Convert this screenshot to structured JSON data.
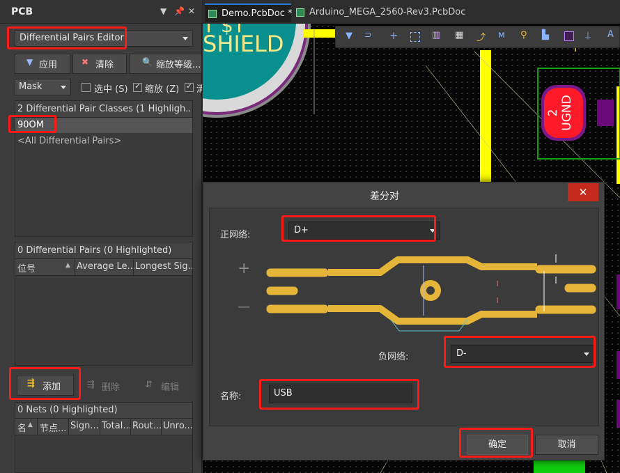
{
  "panel": {
    "title": "PCB",
    "mode_select": "Differential Pairs Editor",
    "buttons": {
      "apply": "应用",
      "clear": "清除",
      "zoom": "缩放等级..."
    },
    "mask_select": "Mask",
    "checkboxes": [
      {
        "label": "选中 (S)",
        "checked": false
      },
      {
        "label": "缩放 (Z)",
        "checked": true
      },
      {
        "label": "清",
        "checked": true
      }
    ],
    "classes_header": "2 Differential Pair Classes (1 Highligh...",
    "classes": [
      "90OM",
      "<All Differential Pairs>"
    ],
    "pairs_header": "0 Differential Pairs (0 Highlighted)",
    "pairs_columns": [
      "位号",
      "Average Le...",
      "Longest Sig..."
    ],
    "actions": {
      "add": "添加",
      "delete": "删除",
      "edit": "编辑"
    },
    "nets_header": "0 Nets (0 Highlighted)",
    "nets_columns": [
      "名",
      "节点...",
      "Sign...",
      "Total...",
      "Rout...",
      "Unro..."
    ]
  },
  "tabs": [
    {
      "label": "Demo.PcbDoc *",
      "active": true
    },
    {
      "label": "Arduino_MEGA_2560-Rev3.PcbDoc",
      "active": false
    }
  ],
  "pcb": {
    "silk_top": "T $T",
    "silk_text": "SHIELD",
    "pad_number": "2",
    "pad_label": "UGND"
  },
  "dialog": {
    "title": "差分对",
    "positive_net_label": "正网络:",
    "positive_net_value": "D+",
    "negative_net_label": "负网络:",
    "negative_net_value": "D-",
    "name_label": "名称:",
    "name_value": "USB",
    "ok": "确定",
    "cancel": "取消",
    "diagram_plus": "+",
    "diagram_minus": "—"
  },
  "colors": {
    "annotation_red": "#ff1a1a",
    "trace_gold": "#e5b53a",
    "close_red": "#c42b1c",
    "pcb_yellow": "#ffff00",
    "pcb_teal": "#008b8b"
  }
}
